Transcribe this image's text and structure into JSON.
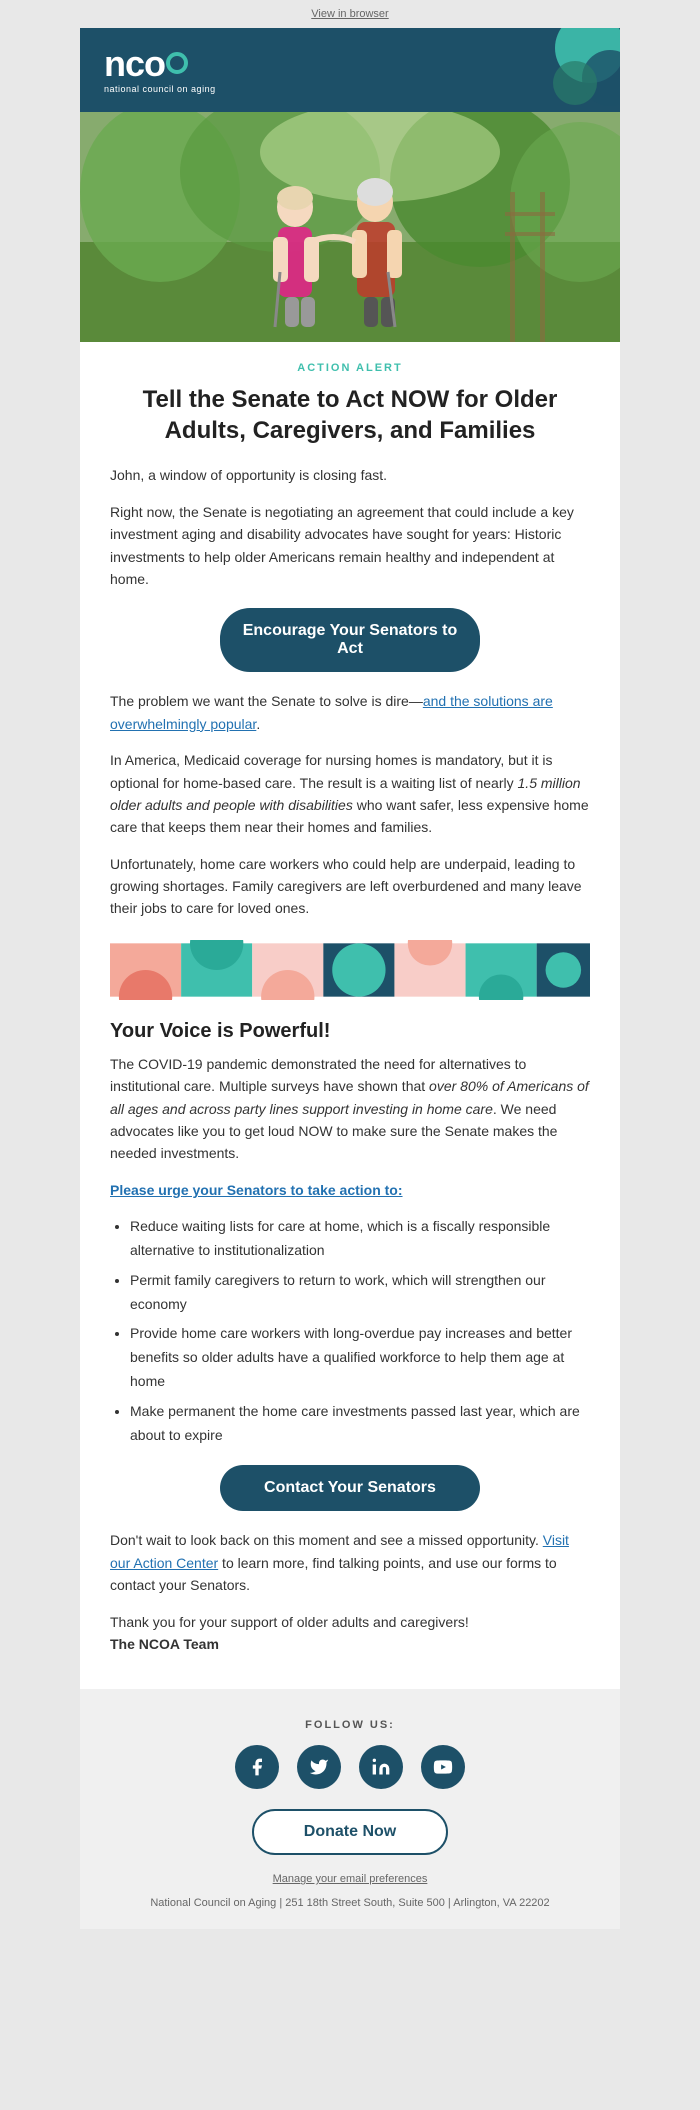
{
  "viewInBrowser": "View in browser",
  "header": {
    "logoText": "ncoa",
    "logoSub": "national council on aging"
  },
  "actionAlert": {
    "label": "ACTION ALERT",
    "title": "Tell the Senate to Act NOW for Older Adults, Caregivers, and Families"
  },
  "body": {
    "para1": "John, a window of opportunity is closing fast.",
    "para2_start": "Right now, the Senate is negotiating an agreement that could include a key investment aging and disability advocates have sought for years: Historic investments to help older Americans remain healthy and independent at home.",
    "cta1": "Encourage Your Senators to Act",
    "para3_start": "The problem we want the Senate to solve is dire—",
    "para3_link": "and the solutions are overwhelmingly popular",
    "para3_end": ".",
    "para4": "In America, Medicaid coverage for nursing homes is mandatory, but it is optional for home-based care. The result is a waiting list of nearly ",
    "para4_italic": "1.5 million older adults and people with disabilities",
    "para4_end": " who want safer, less expensive home care that keeps them near their homes and families.",
    "para5": "Unfortunately, home care workers who could help are underpaid, leading to growing shortages. Family caregivers are left overburdened and many leave their jobs to care for loved ones.",
    "section2_heading": "Your Voice is Powerful!",
    "section2_para1_start": "The COVID-19 pandemic demonstrated the need for alternatives to institutional care. Multiple surveys have shown that ",
    "section2_para1_italic": "over 80% of Americans of all ages and across party lines support investing in home care",
    "section2_para1_end": ". We need advocates like you to get loud NOW to make sure the Senate makes the needed investments.",
    "urge_label": "Please urge your Senators to take action to:",
    "bullet1": "Reduce waiting lists for care at home, which is a fiscally responsible alternative to institutionalization",
    "bullet2": "Permit family caregivers to return to work, which will strengthen our economy",
    "bullet3": "Provide home care workers with long-overdue pay increases and better benefits so older adults have a qualified workforce to help them age at home",
    "bullet4": "Make permanent the home care investments passed last year, which are about to expire",
    "cta2": "Contact Your Senators",
    "para6_start": "Don't wait to look back on this moment and see a missed opportunity. ",
    "para6_link": "Visit our Action Center",
    "para6_end": " to learn more, find talking points, and use our forms to contact your Senators.",
    "para7": "Thank you for your support of older adults and caregivers!",
    "para7_sig": "The NCOA Team"
  },
  "footer": {
    "followLabel": "FOLLOW US:",
    "facebook": "f",
    "twitter": "t",
    "linkedin": "in",
    "youtube": "▶",
    "donateButton": "Donate Now",
    "managePrefs": "Manage your email preferences",
    "address": "National Council on Aging | 251 18th Street South, Suite 500 | Arlington, VA 22202"
  }
}
